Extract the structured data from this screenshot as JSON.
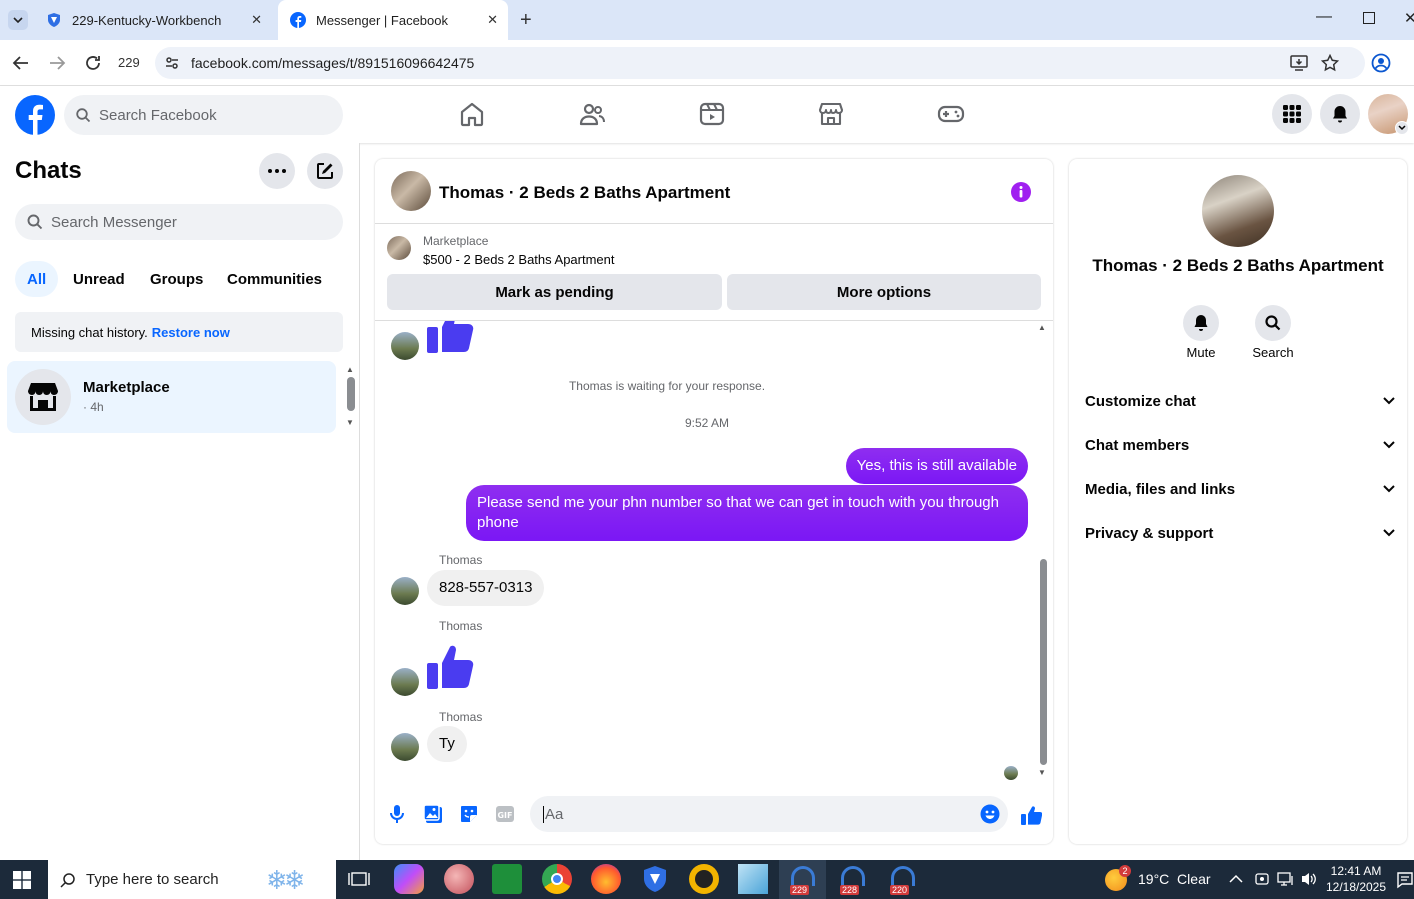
{
  "browser": {
    "tabs": [
      {
        "title": "229-Kentucky-Workbench",
        "active": false
      },
      {
        "title": "Messenger | Facebook",
        "active": true
      }
    ],
    "profile_label": "229",
    "url": "facebook.com/messages/t/891516096642475"
  },
  "fb": {
    "search_placeholder": "Search Facebook",
    "accent": "#0866ff",
    "nav_icons": [
      "home-icon",
      "friends-icon",
      "video-icon",
      "marketplace-icon",
      "gaming-icon"
    ]
  },
  "sidebar": {
    "title": "Chats",
    "search_placeholder": "Search Messenger",
    "filters": [
      "All",
      "Unread",
      "Groups",
      "Communities"
    ],
    "banner_text": "Missing chat history.",
    "banner_link": "Restore now",
    "chat_item": {
      "name": "Marketplace",
      "time": "· 4h"
    }
  },
  "chat": {
    "title": "Thomas · 2 Beds 2 Baths Apartment",
    "marketplace_label": "Marketplace",
    "listing": "$500 - 2 Beds 2 Baths Apartment",
    "btn_pending": "Mark as pending",
    "btn_more": "More options",
    "waiting_text": "Thomas is waiting for your response.",
    "timestamp": "9:52 AM",
    "out_msg_1": "Yes, this is still available",
    "out_msg_2": "Please send me your phn number so that we can get in touch with you through phone",
    "sender": "Thomas",
    "in_msg_phone": "828-557-0313",
    "in_msg_ty": "Ty",
    "composer_placeholder": "Aa",
    "bubble_color": "#7b17f5"
  },
  "right": {
    "name": "Thomas · 2 Beds 2 Baths Apartment",
    "mute": "Mute",
    "search": "Search",
    "sections": [
      "Customize chat",
      "Chat members",
      "Media, files and links",
      "Privacy & support"
    ]
  },
  "taskbar": {
    "search_placeholder": "Type here to search",
    "weather": "19°C  Clear",
    "weather_badge": "2",
    "time": "12:41 AM",
    "date": "12/18/2025",
    "app_badges": [
      "229",
      "228",
      "220"
    ]
  }
}
